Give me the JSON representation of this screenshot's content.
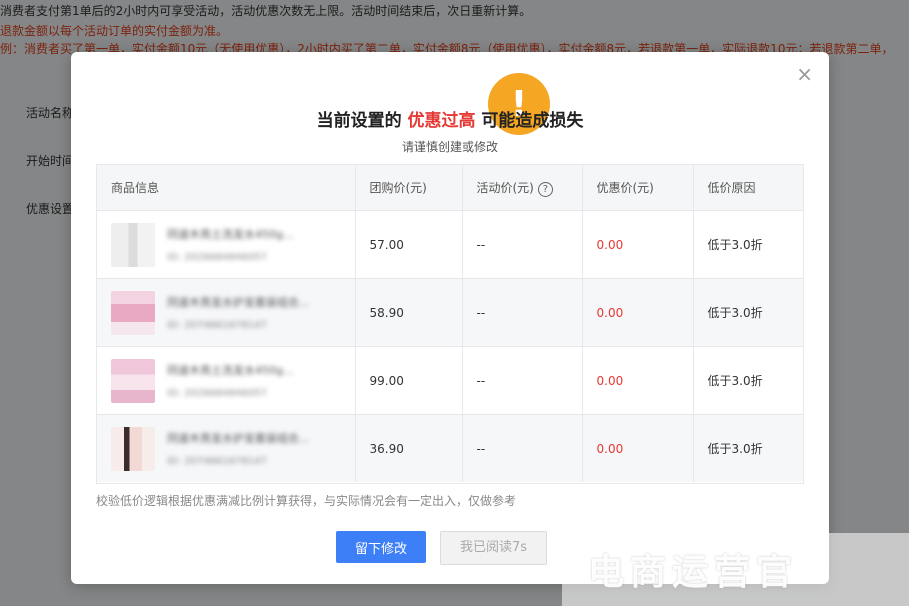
{
  "background": {
    "line1": "消费者支付第1单后的2小时内可享受活动，活动优惠次数无上限。活动时间结束后，次日重新计算。",
    "line2": "退款金额以每个活动订单的实付金额为准。",
    "line3": "例：消费者买了第一单，实付金额10元（无使用优惠），2小时内买了第二单，实付金额8元（使用优惠），实付金额8元，若退款第一单，实际退款10元；若退款第二单，",
    "fields": [
      "活动名称",
      "开始时间",
      "优惠设置"
    ]
  },
  "modal": {
    "warn_icon": "exclamation-icon",
    "warn_glyph": "!",
    "close_glyph": "×",
    "title_prefix": "当前设置的",
    "title_highlight": "优惠过高",
    "title_suffix": "可能造成损失",
    "subtitle": "请谨慎创建或修改",
    "table": {
      "headers": [
        "商品信息",
        "团购价(元)",
        "活动价(元)",
        "优惠价(元)",
        "低价原因"
      ],
      "rows": [
        {
          "thumb": "t1",
          "name": "同道木亮土洗发水450g...",
          "id": "ID: 2026684846057",
          "group_price": "57.00",
          "activity_price": "--",
          "discount_price": "0.00",
          "reason": "低于3.0折"
        },
        {
          "thumb": "t2",
          "name": "同道木亮发水护发套装组合...",
          "id": "ID: 2074661678147",
          "group_price": "58.90",
          "activity_price": "--",
          "discount_price": "0.00",
          "reason": "低于3.0折"
        },
        {
          "thumb": "t3",
          "name": "同道木亮土洗发水450g...",
          "id": "ID: 2026684846057",
          "group_price": "99.00",
          "activity_price": "--",
          "discount_price": "0.00",
          "reason": "低于3.0折"
        },
        {
          "thumb": "t4",
          "name": "同道木亮发水护发套装组合...",
          "id": "ID: 2074661678147",
          "group_price": "36.90",
          "activity_price": "--",
          "discount_price": "0.00",
          "reason": "低于3.0折"
        }
      ]
    },
    "note": "校验低价逻辑根据优惠满减比例计算获得，与实际情况会有一定出入，仅做参考",
    "primary_button": "留下修改",
    "secondary_button": "我已阅读7s"
  },
  "watermark": "电商运营官",
  "colors": {
    "accent": "#3d7ff6",
    "warning": "#f5a623",
    "danger": "#e53935"
  }
}
